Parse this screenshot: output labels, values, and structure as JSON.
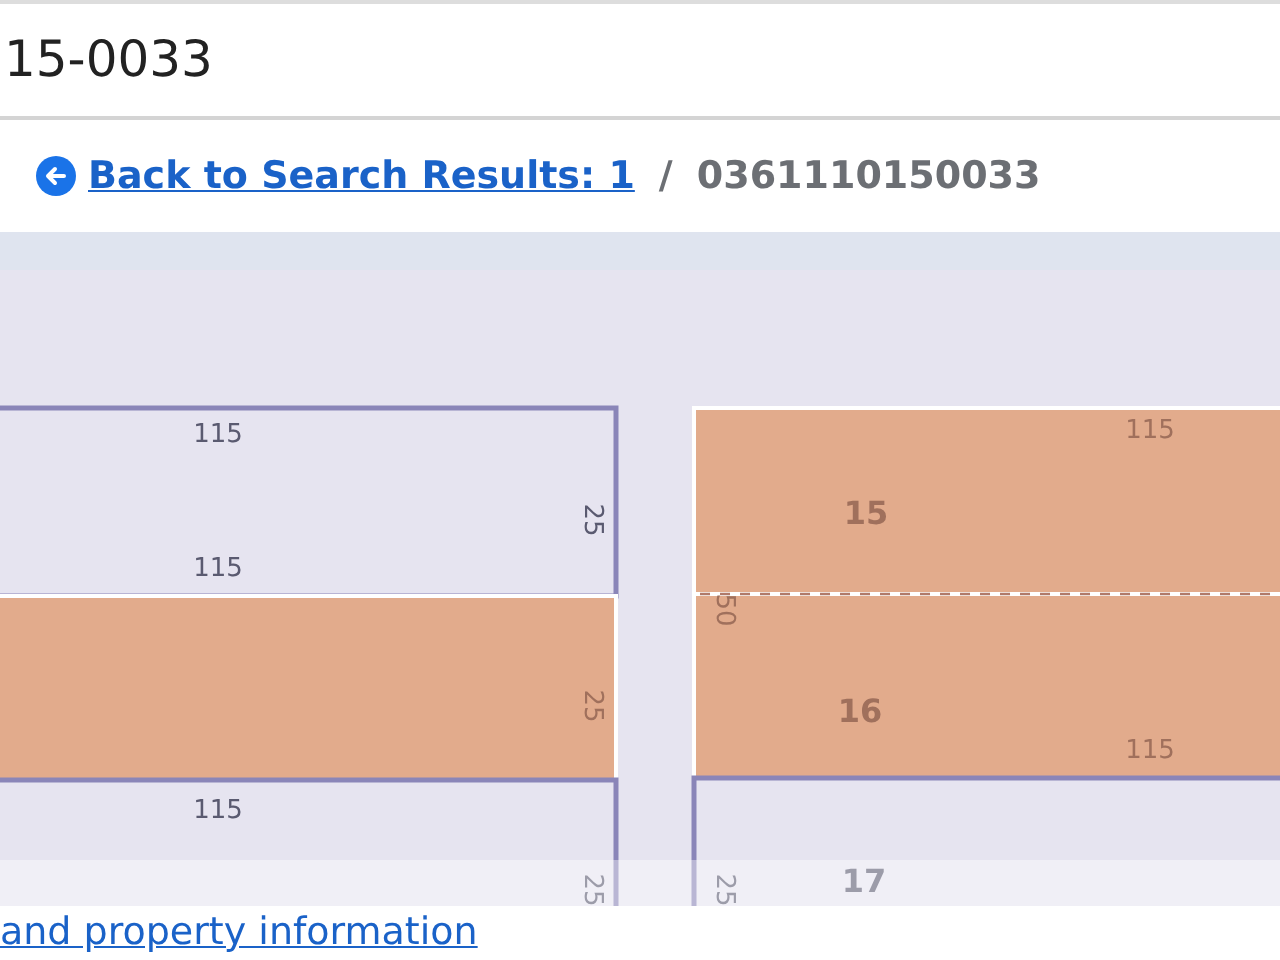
{
  "search_field": {
    "value": "15-0033"
  },
  "breadcrumb": {
    "back_link": "Back to Search Results: 1",
    "separator": "/",
    "current": "0361110150033"
  },
  "map": {
    "parcels": [
      {
        "highlighted": false,
        "labels": [
          {
            "kind": "dimension",
            "text": "115"
          },
          {
            "kind": "dimension",
            "text": "115"
          },
          {
            "kind": "side",
            "text": "25"
          }
        ]
      },
      {
        "highlighted": true,
        "labels": [
          {
            "kind": "side",
            "text": "25"
          }
        ]
      },
      {
        "highlighted": false,
        "labels": [
          {
            "kind": "dimension",
            "text": "115"
          },
          {
            "kind": "side",
            "text": "25"
          }
        ]
      },
      {
        "highlighted": true,
        "labels": [
          {
            "kind": "number",
            "text": "15"
          },
          {
            "kind": "dimension",
            "text": "115"
          },
          {
            "kind": "side",
            "text": "50"
          }
        ]
      },
      {
        "highlighted": true,
        "labels": [
          {
            "kind": "number",
            "text": "16"
          },
          {
            "kind": "dimension",
            "text": "115"
          }
        ]
      },
      {
        "highlighted": false,
        "labels": [
          {
            "kind": "number",
            "text": "17"
          },
          {
            "kind": "side",
            "text": "25"
          }
        ]
      }
    ]
  },
  "footer_link": "and property information"
}
